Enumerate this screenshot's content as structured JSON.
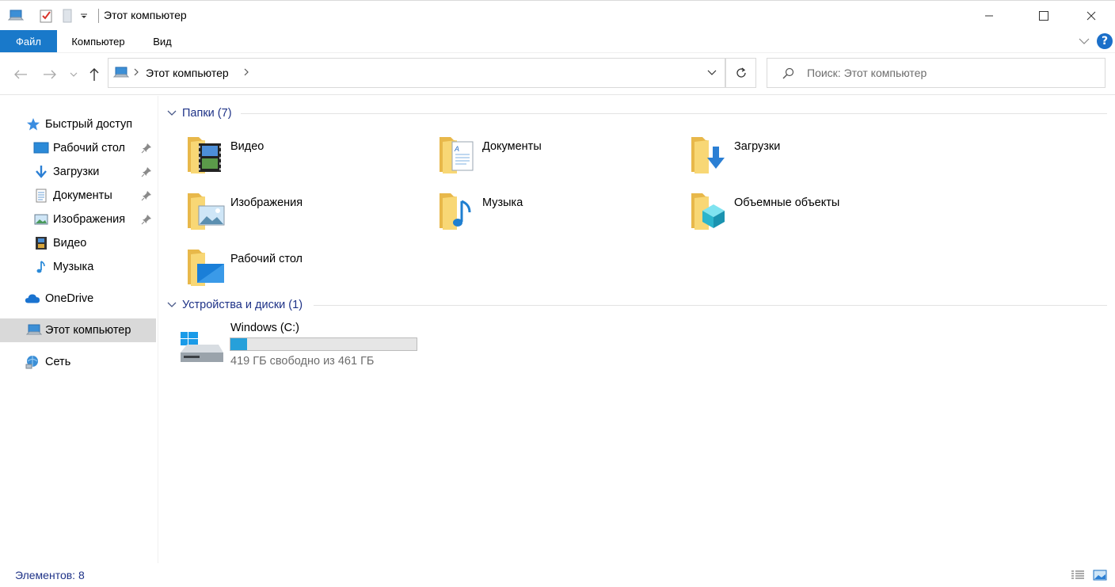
{
  "window": {
    "title": "Этот компьютер"
  },
  "ribbon": {
    "tabs": [
      "Файл",
      "Компьютер",
      "Вид"
    ],
    "help_label": "?"
  },
  "navigation": {
    "breadcrumb": [
      "Этот компьютер"
    ],
    "search_placeholder": "Поиск: Этот компьютер"
  },
  "sidebar": {
    "items": [
      {
        "label": "Быстрый доступ",
        "icon": "star-icon"
      },
      {
        "label": "Рабочий стол",
        "icon": "desktop-icon",
        "pinned": true
      },
      {
        "label": "Загрузки",
        "icon": "download-icon",
        "pinned": true
      },
      {
        "label": "Документы",
        "icon": "document-icon",
        "pinned": true
      },
      {
        "label": "Изображения",
        "icon": "image-icon",
        "pinned": true
      },
      {
        "label": "Видео",
        "icon": "video-icon"
      },
      {
        "label": "Музыка",
        "icon": "music-icon"
      },
      {
        "label": "OneDrive",
        "icon": "cloud-icon"
      },
      {
        "label": "Этот компьютер",
        "icon": "computer-icon",
        "selected": true
      },
      {
        "label": "Сеть",
        "icon": "network-icon"
      }
    ]
  },
  "main": {
    "folders_header": "Папки (7)",
    "folders": [
      {
        "label": "Видео",
        "icon": "video-folder-icon"
      },
      {
        "label": "Документы",
        "icon": "documents-folder-icon"
      },
      {
        "label": "Загрузки",
        "icon": "downloads-folder-icon"
      },
      {
        "label": "Изображения",
        "icon": "pictures-folder-icon"
      },
      {
        "label": "Музыка",
        "icon": "music-folder-icon"
      },
      {
        "label": "Объемные объекты",
        "icon": "3d-objects-folder-icon"
      },
      {
        "label": "Рабочий стол",
        "icon": "desktop-folder-icon"
      }
    ],
    "devices_header": "Устройства и диски (1)",
    "drives": [
      {
        "label": "Windows (C:)",
        "free_text": "419 ГБ свободно из 461 ГБ",
        "used_fraction": 0.09
      }
    ]
  },
  "status": {
    "items_count": "Элементов: 8"
  },
  "colors": {
    "accent": "#1979ca",
    "group_header": "#1e3287",
    "selected_bg": "#d9d9d9",
    "drive_fill": "#26a0da",
    "folder_yellow": "#f8d775"
  }
}
